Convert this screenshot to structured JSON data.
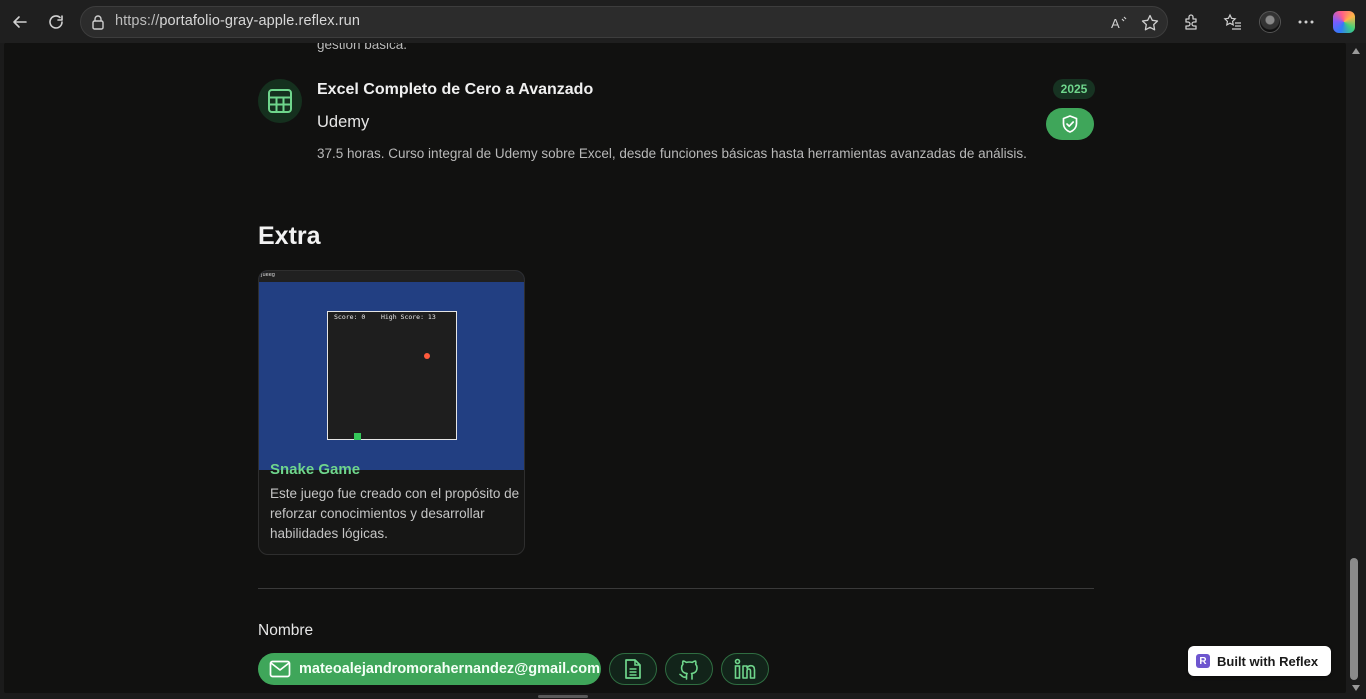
{
  "browser": {
    "url_host": "https://",
    "url_rest": "portafolio-gray-apple.reflex.run"
  },
  "page": {
    "previous_text": "gestión básica.",
    "course": {
      "title": "Excel Completo de Cero a Avanzado",
      "organization": "Udemy",
      "description": "37.5 horas. Curso integral de Udemy sobre Excel, desde funciones básicas hasta herramientas avanzadas de análisis.",
      "year": "2025",
      "icon": "spreadsheet-icon"
    },
    "extra": {
      "section_title": "Extra",
      "project": {
        "title": "Snake Game",
        "description": "Este juego fue creado con el propósito de reforzar conocimientos y desarrollar habilidades lógicas.",
        "image": {
          "window_title": "Jueeg",
          "score_text": "Score: 0    High Score: 13"
        }
      }
    },
    "footer": {
      "name": "Nombre",
      "email": "mateoalejandromorahernandez@gmail.com"
    },
    "badge": {
      "logo": "R",
      "label": "Built with Reflex"
    }
  },
  "colors": {
    "accent": "#3fa65a",
    "accent_text": "#6fd68c",
    "background": "#111110"
  }
}
